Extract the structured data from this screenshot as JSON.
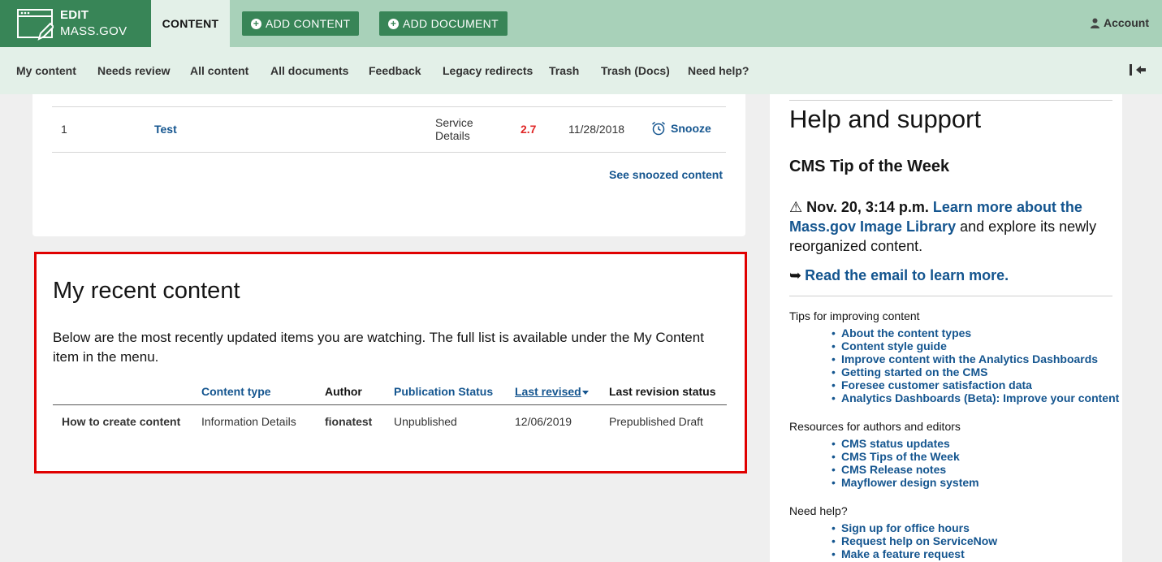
{
  "brand": {
    "line1": "EDIT",
    "line2": "MASS.GOV"
  },
  "toolbar": {
    "content_tab": "CONTENT",
    "add_content": "ADD CONTENT",
    "add_document": "ADD DOCUMENT",
    "account": "Account"
  },
  "subnav": [
    "My content",
    "Needs review",
    "All content",
    "All documents",
    "Feedback",
    "Legacy redirects",
    "Trash",
    "Trash (Docs)",
    "Need help?"
  ],
  "review_table": {
    "row": {
      "num": "1",
      "title": "Test",
      "type_line1": "Service",
      "type_line2": "Details",
      "score": "2.7",
      "date": "11/28/2018",
      "action": "Snooze"
    },
    "see_snoozed": "See snoozed content"
  },
  "recent": {
    "title": "My recent content",
    "description": "Below are the most recently updated items you are watching. The full list is available under the My Content item in the menu.",
    "headers": {
      "content_type": "Content type",
      "author": "Author",
      "publication_status": "Publication Status",
      "last_revised": "Last revised",
      "last_revision_status": "Last revision status"
    },
    "row": {
      "title": "How to create content",
      "content_type": "Information Details",
      "author": "fionatest",
      "publication_status": "Unpublished",
      "last_revised": "12/06/2019",
      "last_revision_status": "Prepublished Draft"
    }
  },
  "help": {
    "title": "Help and support",
    "tip_heading": "CMS Tip of the Week",
    "tip_date": "Nov. 20, 3:14 p.m.",
    "tip_link": "Learn more about the Mass.gov Image Library",
    "tip_rest": "and explore its newly reorganized content.",
    "read_more": "Read the email to learn more.",
    "sections": [
      {
        "label": "Tips for improving content",
        "links": [
          "About the content types",
          "Content style guide",
          "Improve content with the Analytics Dashboards",
          "Getting started on the CMS",
          "Foresee customer satisfaction data",
          "Analytics Dashboards (Beta): Improve your content"
        ]
      },
      {
        "label": "Resources for authors and editors",
        "links": [
          "CMS status updates",
          "CMS Tips of the Week",
          "CMS Release notes",
          "Mayflower design system"
        ]
      },
      {
        "label": "Need help?",
        "links": [
          "Sign up for office hours",
          "Request help on ServiceNow",
          "Make a feature request"
        ]
      }
    ]
  },
  "colors": {
    "brand_green": "#388557",
    "header_light_green": "#a8d1b9",
    "subnav_bg": "#e3f0e8",
    "link_blue": "#14558f",
    "highlight_red": "#e00000",
    "score_red": "#e02727"
  }
}
